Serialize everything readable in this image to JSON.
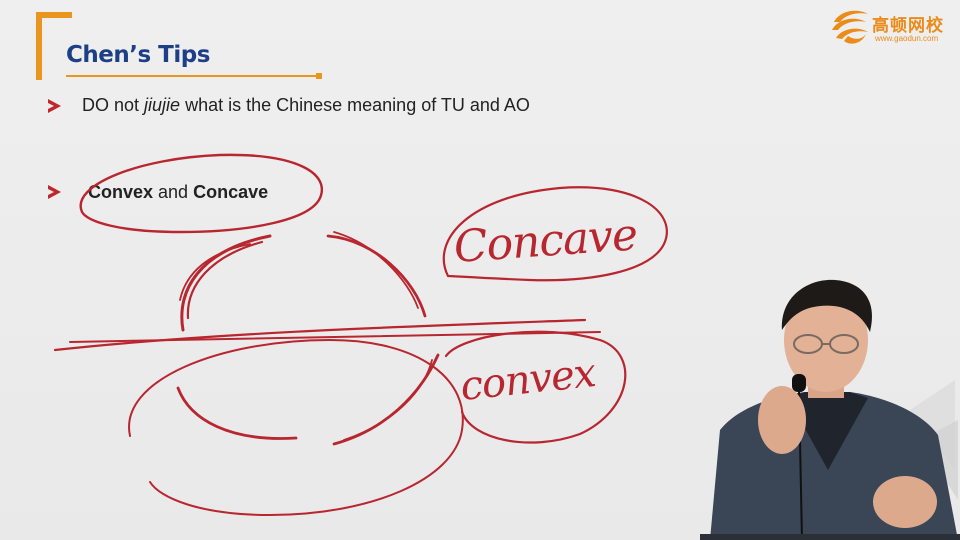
{
  "header": {
    "title": "Chen’s Tips"
  },
  "logo": {
    "name": "高顿网校",
    "url": "www.gaodun.com"
  },
  "bullets": [
    {
      "pre": "DO not ",
      "italic": "jiujie",
      "post": " what is the Chinese meaning of TU and AO"
    },
    {
      "word1": "Convex",
      "middle": " and ",
      "word2": "Concave"
    }
  ],
  "annotations": {
    "concave_word": "Concave",
    "convex_word": "convex"
  },
  "colors": {
    "accent": "#e8961e",
    "title": "#1d3f86",
    "ink": "#b8262f",
    "bullet_arrow": "#c0272d"
  }
}
